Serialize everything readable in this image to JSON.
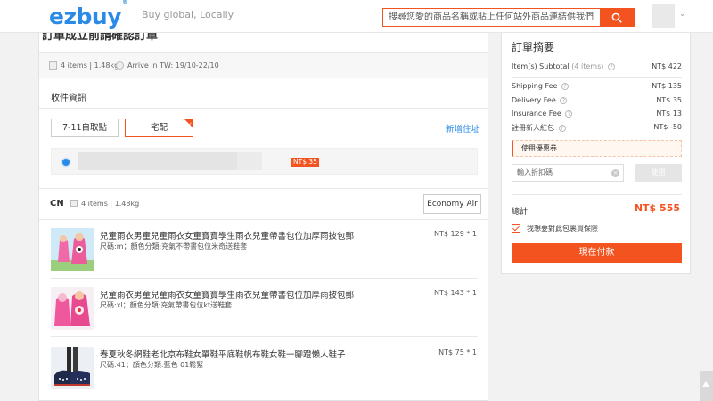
{
  "header": {
    "logo": "ezbuy",
    "logo_mark": "®",
    "tagline": "Buy global, Locally",
    "search_placeholder": "搜尋您愛的商品名稱或貼上任何站外商品連結供我們代購"
  },
  "shipping": {
    "cut_title": "訂單成立前請確認訂單",
    "items_summary": "4 items | 1.48kg",
    "arrive": "Arrive in TW: 19/10-22/10"
  },
  "receiver": {
    "section_title": "收件資訊",
    "options": [
      "7-11自取點",
      "宅配"
    ],
    "selected_option": "宅配",
    "new_address_link": "新增住址",
    "address_price": "NT$ 35"
  },
  "warehouse": {
    "label": "CN",
    "items_summary": "4 items | 1.48kg",
    "method_button": "Economy Air"
  },
  "products": [
    {
      "name": "兒童雨衣男童兒童雨衣女童寶寶學生雨衣兒童帶書包位加厚雨披包郵",
      "attr": "尺碼:m；顏色分類:充氣不帶書包位米奇送鞋套",
      "price": "NT$ 129 * 1"
    },
    {
      "name": "兒童雨衣男童兒童雨衣女童寶寶學生雨衣兒童帶書包位加厚雨披包郵",
      "attr": "尺碼:xl；顏色分類:充氣帶書包位kt送鞋套",
      "price": "NT$ 143 * 1"
    },
    {
      "name": "春夏秋冬網鞋老北京布鞋女單鞋平底鞋帆布鞋女鞋一腳蹬懶人鞋子",
      "attr": "尺碼:41；顏色分類:藍色 01鬆緊",
      "price": "NT$ 75 * 1"
    }
  ],
  "summary": {
    "title": "訂單摘要",
    "subtotal_label": "Item(s) Subtotal",
    "subtotal_count": "(4 items)",
    "subtotal_value": "NT$ 422",
    "shipping_fee_label": "Shipping Fee",
    "shipping_fee_value": "NT$ 135",
    "delivery_fee_label": "Delivery Fee",
    "delivery_fee_value": "NT$ 35",
    "insurance_fee_label": "Insurance Fee",
    "insurance_fee_value": "NT$ 13",
    "new_user_label": "註冊新人紅包",
    "new_user_value": "NT$ -50",
    "coupon_label": "使用優惠券",
    "coupon_placeholder": "輸入折扣碼",
    "use_button": "使用",
    "total_label": "總計",
    "total_value": "NT$ 555",
    "insurance_text": "我想要對此包裹買保險",
    "insurance_checked": true,
    "pay_button": "現在付款"
  },
  "colors": {
    "accent": "#f2531f",
    "brand_blue": "#2a8ae8"
  }
}
